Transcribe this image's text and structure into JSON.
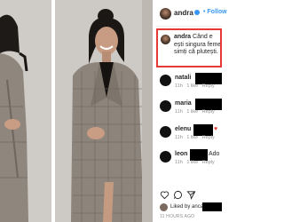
{
  "post": {
    "username": "andra",
    "follow_label": "• Follow"
  },
  "caption": {
    "username": "andra",
    "line1": "Când e",
    "line2": "ești singura feme",
    "line3": "simți că plutești."
  },
  "comments": [
    {
      "username": "natali",
      "text": "",
      "meta_time": "11h",
      "meta_likes": "1 like",
      "meta_reply": "Reply"
    },
    {
      "username": "maria",
      "text": "",
      "meta_time": "11h",
      "meta_likes": "1 like",
      "meta_reply": "Reply"
    },
    {
      "username": "elenu",
      "text": "♥",
      "meta_time": "11h",
      "meta_likes": "1 like",
      "meta_reply": "Reply"
    },
    {
      "username": "leon",
      "text": "Ado",
      "meta_time": "11h",
      "meta_likes": "1 like",
      "meta_reply": "Reply"
    }
  ],
  "likes": {
    "text": "Liked by anca"
  },
  "timestamp": "11 HOURS AGO",
  "colors": {
    "highlight": "#e53935",
    "verified": "#3897f0",
    "accent": "#3897f0"
  },
  "icons": [
    "heart-icon",
    "comment-icon",
    "share-icon",
    "verified-icon"
  ]
}
